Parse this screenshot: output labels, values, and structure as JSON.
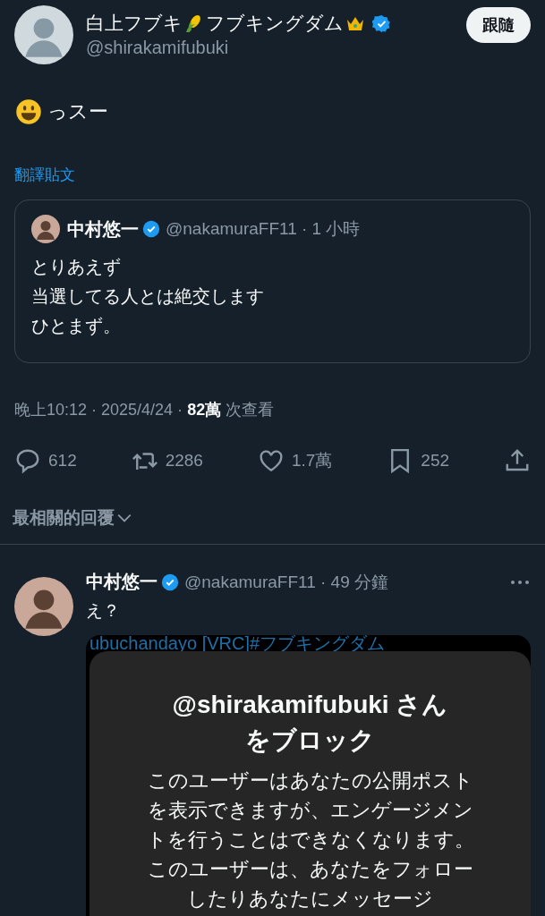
{
  "post": {
    "author": {
      "name_parts": [
        "白上フブキ",
        "フブキングダム"
      ],
      "verified": true,
      "handle": "@shirakamifubuki"
    },
    "follow_button": "跟隨",
    "text": "っスー",
    "translate_link": "翻譯貼文",
    "quote": {
      "name": "中村悠一",
      "verified": true,
      "byline": "@nakamuraFF11 · 1 小時",
      "lines": [
        "とりあえず",
        "当選してる人とは絶交します",
        "ひとまず。"
      ]
    },
    "meta": "晚上10:12 · 2025/4/24 · **82萬** 次查看",
    "actions": [
      {
        "kind": "reply",
        "count": "612"
      },
      {
        "kind": "repost",
        "count": "2286"
      },
      {
        "kind": "like",
        "count": "1.7萬"
      },
      {
        "kind": "bookmark",
        "count": "252"
      },
      {
        "kind": "share"
      }
    ]
  },
  "sort": {
    "label": "最相關的回覆"
  },
  "reply": {
    "name": "中村悠一",
    "verified": true,
    "byline": "@nakamuraFF11 · 49 分鐘",
    "text": "え？",
    "image": {
      "background_text": "ubuchandayo [VRC]#フブキングダム",
      "dialog_title_lines": [
        "@shirakamifubuki さん",
        "をブロック"
      ],
      "dialog_body": "このユーザーはあなたの公開ポストを表示できますが、エンゲージメントを行うことはできなくなります。このユーザーは、あなたをフォローしたりあなたにメッセージ"
    }
  }
}
